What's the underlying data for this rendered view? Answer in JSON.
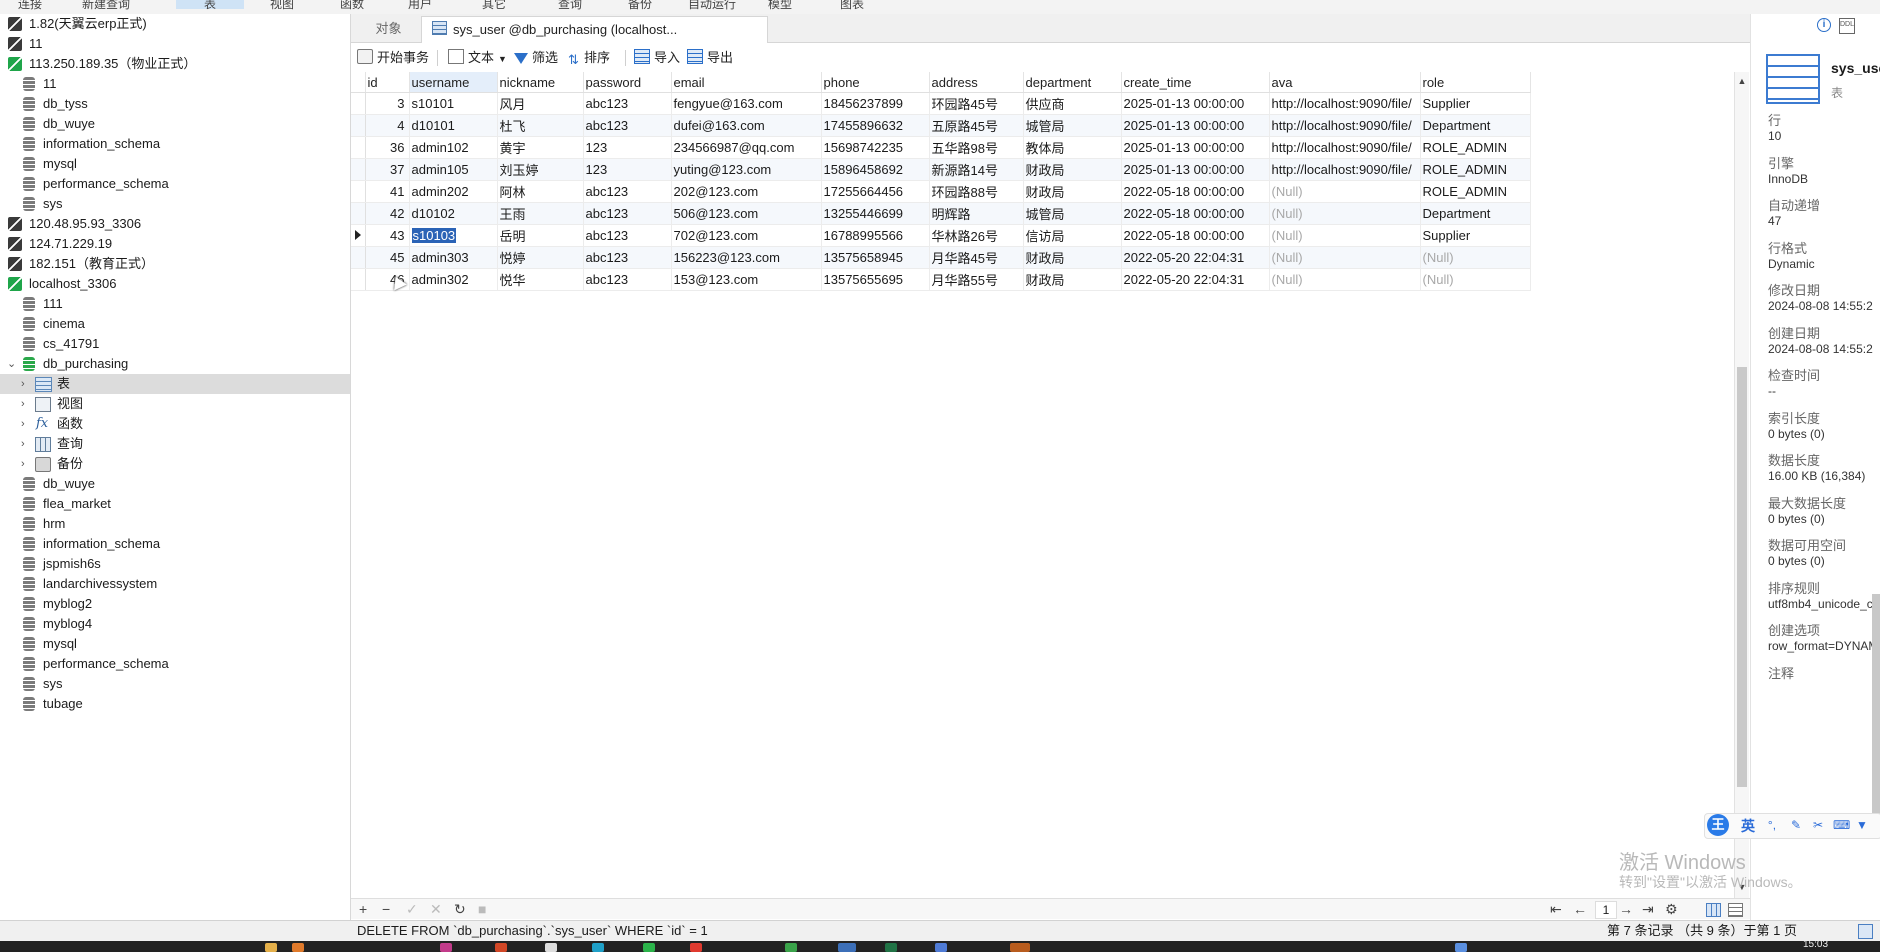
{
  "menubar": {
    "items": [
      "连接",
      "新建查询",
      "表",
      "视图",
      "函数",
      "用户",
      "其它",
      "查询",
      "备份",
      "自动运行",
      "模型",
      "图表"
    ]
  },
  "navigator": {
    "items": [
      {
        "label": "1.82(天翼云erp正式)",
        "kind": "connection"
      },
      {
        "label": "11",
        "kind": "connection"
      },
      {
        "label": "113.250.189.35（物业正式）",
        "kind": "connection-open"
      },
      {
        "label": "11",
        "kind": "database"
      },
      {
        "label": "db_tyss",
        "kind": "database"
      },
      {
        "label": "db_wuye",
        "kind": "database"
      },
      {
        "label": "information_schema",
        "kind": "database"
      },
      {
        "label": "mysql",
        "kind": "database"
      },
      {
        "label": "performance_schema",
        "kind": "database"
      },
      {
        "label": "sys",
        "kind": "database"
      },
      {
        "label": "120.48.95.93_3306",
        "kind": "connection"
      },
      {
        "label": "124.71.229.19",
        "kind": "connection"
      },
      {
        "label": "182.151（教育正式）",
        "kind": "connection"
      },
      {
        "label": "localhost_3306",
        "kind": "connection-open"
      },
      {
        "label": "111",
        "kind": "database"
      },
      {
        "label": "cinema",
        "kind": "database"
      },
      {
        "label": "cs_41791",
        "kind": "database"
      },
      {
        "label": "db_purchasing",
        "kind": "database-open"
      },
      {
        "label": "表",
        "kind": "tables"
      },
      {
        "label": "视图",
        "kind": "views"
      },
      {
        "label": "函数",
        "kind": "functions"
      },
      {
        "label": "查询",
        "kind": "queries"
      },
      {
        "label": "备份",
        "kind": "backups"
      },
      {
        "label": "db_wuye",
        "kind": "database"
      },
      {
        "label": "flea_market",
        "kind": "database"
      },
      {
        "label": "hrm",
        "kind": "database"
      },
      {
        "label": "information_schema",
        "kind": "database"
      },
      {
        "label": "jspmish6s",
        "kind": "database"
      },
      {
        "label": "landarchivessystem",
        "kind": "database"
      },
      {
        "label": "myblog2",
        "kind": "database"
      },
      {
        "label": "myblog4",
        "kind": "database"
      },
      {
        "label": "mysql",
        "kind": "database"
      },
      {
        "label": "performance_schema",
        "kind": "database"
      },
      {
        "label": "sys",
        "kind": "database"
      },
      {
        "label": "tubage",
        "kind": "database"
      }
    ],
    "selected_label": "表"
  },
  "tabs": {
    "objects_label": "对象",
    "active_label": "sys_user @db_purchasing (localhost..."
  },
  "toolbar": {
    "begin_transaction": "开始事务",
    "text": "文本",
    "filter": "筛选",
    "sort": "排序",
    "import": "导入",
    "export": "导出"
  },
  "grid": {
    "columns": [
      "id",
      "username",
      "nickname",
      "password",
      "email",
      "phone",
      "address",
      "department",
      "create_time",
      "ava",
      "role"
    ],
    "rows": [
      [
        "3",
        "s10101",
        "风月",
        "abc123",
        "fengyue@163.com",
        "18456237899",
        "环园路45号",
        "供应商",
        "2025-01-13 00:00:00",
        "http://localhost:9090/file/",
        "Supplier"
      ],
      [
        "4",
        "d10101",
        "杜飞",
        "abc123",
        "dufei@163.com",
        "17455896632",
        "五原路45号",
        "城管局",
        "2025-01-13 00:00:00",
        "http://localhost:9090/file/",
        "Department"
      ],
      [
        "36",
        "admin102",
        "黄宇",
        "123",
        "234566987@qq.com",
        "15698742235",
        "五华路98号",
        "教体局",
        "2025-01-13 00:00:00",
        "http://localhost:9090/file/",
        "ROLE_ADMIN"
      ],
      [
        "37",
        "admin105",
        "刘玉婷",
        "123",
        "yuting@123.com",
        "15896458692",
        "新源路14号",
        "财政局",
        "2025-01-13 00:00:00",
        "http://localhost:9090/file/",
        "ROLE_ADMIN"
      ],
      [
        "41",
        "admin202",
        "阿林",
        "abc123",
        "202@123.com",
        "17255664456",
        "环园路88号",
        "财政局",
        "2022-05-18 00:00:00",
        "(Null)",
        "ROLE_ADMIN"
      ],
      [
        "42",
        "d10102",
        "王雨",
        "abc123",
        "506@123.com",
        "13255446699",
        "明辉路",
        "城管局",
        "2022-05-18 00:00:00",
        "(Null)",
        "Department"
      ],
      [
        "43",
        "s10103",
        "岳明",
        "abc123",
        "702@123.com",
        "16788995566",
        "华林路26号",
        "信访局",
        "2022-05-18 00:00:00",
        "(Null)",
        "Supplier"
      ],
      [
        "45",
        "admin303",
        "悦婷",
        "abc123",
        "156223@123.com",
        "13575658945",
        "月华路45号",
        "财政局",
        "2022-05-20 22:04:31",
        "(Null)",
        "(Null)"
      ],
      [
        "46",
        "admin302",
        "悦华",
        "abc123",
        "153@123.com",
        "13575655695",
        "月华路55号",
        "财政局",
        "2022-05-20 22:04:31",
        "(Null)",
        "(Null)"
      ]
    ],
    "current_row_index": 6,
    "selected_cell_column": "username"
  },
  "grid_footer": {
    "add": "+",
    "delete": "−",
    "apply": "✓",
    "discard": "✕",
    "refresh": "↻",
    "stop": "■",
    "first": "⇤",
    "prev": "←",
    "page": "1",
    "next": "→",
    "last": "⇥",
    "settings": "⚙"
  },
  "status": {
    "sql": "DELETE FROM `db_purchasing`.`sys_user` WHERE `id` = 1",
    "record_info": "第 7 条记录 （共 9 条）于第 1 页"
  },
  "info_panel": {
    "table_name": "sys_use",
    "table_type": "表",
    "properties": [
      {
        "label": "行",
        "value": "10"
      },
      {
        "label": "引擎",
        "value": "InnoDB"
      },
      {
        "label": "自动递增",
        "value": "47"
      },
      {
        "label": "行格式",
        "value": "Dynamic"
      },
      {
        "label": "修改日期",
        "value": "2024-08-08 14:55:2"
      },
      {
        "label": "创建日期",
        "value": "2024-08-08 14:55:2"
      },
      {
        "label": "检查时间",
        "value": "--"
      },
      {
        "label": "索引长度",
        "value": "0 bytes (0)"
      },
      {
        "label": "数据长度",
        "value": "16.00 KB (16,384)"
      },
      {
        "label": "最大数据长度",
        "value": "0 bytes (0)"
      },
      {
        "label": "数据可用空间",
        "value": "0 bytes (0)"
      },
      {
        "label": "排序规则",
        "value": "utf8mb4_unicode_ci"
      },
      {
        "label": "创建选项",
        "value": "row_format=DYNAMI"
      },
      {
        "label": "注释",
        "value": ""
      }
    ]
  },
  "ime": {
    "logo": "王",
    "lang": "英"
  },
  "watermark": {
    "line1": "激活 Windows",
    "line2": "转到\"设置\"以激活 Windows。"
  },
  "taskbar": {
    "clock": "15:03"
  },
  "colors": {
    "accent": "#2b63b6",
    "selection_row": "#dcdcdc",
    "conn_green": "#1fa54a"
  }
}
